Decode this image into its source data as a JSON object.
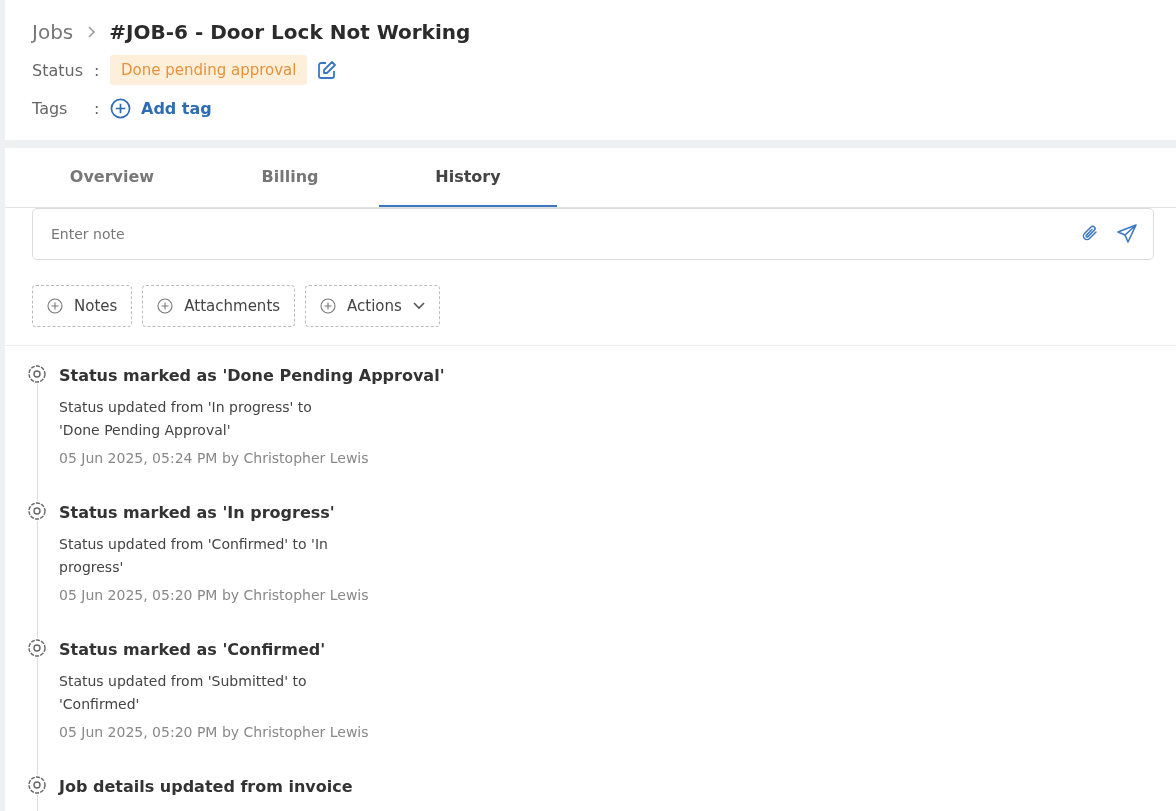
{
  "breadcrumb": {
    "parent": "Jobs",
    "title": "#JOB-6 - Door Lock Not Working"
  },
  "status": {
    "label": "Status",
    "separator": ":",
    "value": "Done pending approval"
  },
  "tags": {
    "label": "Tags",
    "separator": ":",
    "add": "Add tag"
  },
  "tabs": [
    {
      "label": "Overview",
      "selected": false
    },
    {
      "label": "Billing",
      "selected": false
    },
    {
      "label": "History",
      "selected": true
    }
  ],
  "note": {
    "placeholder": "Enter note"
  },
  "buttons": [
    {
      "label": "Notes",
      "dropdown": false
    },
    {
      "label": "Attachments",
      "dropdown": false
    },
    {
      "label": "Actions",
      "dropdown": true
    }
  ],
  "history": [
    {
      "title": "Status marked as 'Done Pending Approval'",
      "description": "Status updated from 'In progress' to 'Done Pending Approval'",
      "meta": "05 Jun 2025, 05:24 PM by Christopher Lewis"
    },
    {
      "title": "Status marked as 'In progress'",
      "description": "Status updated from 'Confirmed' to 'In progress'",
      "meta": "05 Jun 2025, 05:20 PM by Christopher Lewis"
    },
    {
      "title": "Status marked as 'Confirmed'",
      "description": "Status updated from 'Submitted' to 'Confirmed'",
      "meta": "05 Jun 2025, 05:20 PM by Christopher Lewis"
    },
    {
      "title": "Job details updated from invoice"
    }
  ]
}
